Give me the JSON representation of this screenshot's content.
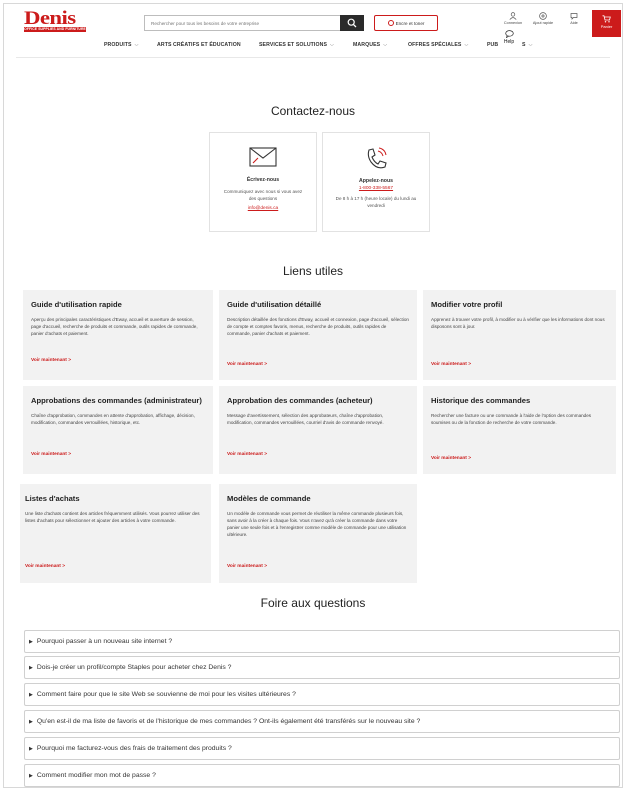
{
  "header": {
    "logo_main": "Denis",
    "logo_sub": "OFFICE SUPPLIES AND FURNITURE",
    "search_placeholder": "Rechercher pour tous les besoins de votre entreprise",
    "ink_button": "Encre et toner",
    "utilities": [
      {
        "label": "Connexion",
        "icon": "user-icon"
      },
      {
        "label": "Ajout rapide",
        "icon": "quick-add-icon"
      },
      {
        "label": "Aide",
        "icon": "chat-icon"
      }
    ],
    "cart_label": "Panier",
    "help_popup": "Help"
  },
  "nav": [
    {
      "label": "PRODUITS"
    },
    {
      "label": "ARTS CRÉATIFS ET ÉDUCATION"
    },
    {
      "label": "SERVICES ET SOLUTIONS"
    },
    {
      "label": "MARQUES"
    },
    {
      "label": "OFFRES SPÉCIALES"
    },
    {
      "label": "PUB"
    },
    {
      "label": "S"
    }
  ],
  "contact": {
    "title": "Contactez-nous",
    "email": {
      "title": "Écrivez-nous",
      "desc": "Communiquez avec nous si vous avez des questions",
      "link": "info@denis.ca"
    },
    "phone": {
      "title": "Appelez-nous",
      "link": "1-800-338-5567",
      "desc": "De 8 h à 17 h (heure locale) du lundi au vendredi"
    }
  },
  "useful_links": {
    "title": "Liens utiles",
    "cta": "Voir maintenant >",
    "cards": [
      {
        "title": "Guide d'utilisation rapide",
        "desc": "Aperçu des principales caractéristiques d'Eway, accueil et ouverture de session, page d'accueil, recherche de produits et commande, outils rapides de commande, panier d'achats et paiement."
      },
      {
        "title": "Guide d'utilisation détaillé",
        "desc": "Description détaillée des fonctions d'Eway, accueil et connexion, page d'accueil, sélection de compte et comptes favoris, menus, recherche de produits, outils rapides de commande, panier d'achats et paiement."
      },
      {
        "title": "Modifier votre profil",
        "desc": "Apprenez à trouver votre profil, à modifier ou à vérifier que les informations dont nous disposons sont à jour."
      },
      {
        "title": "Approbations des commandes (administrateur)",
        "desc": "Chaîne d'approbation, commandes en attente d'approbation, affichage, décision, modification, commandes verrouillées, historique, etc."
      },
      {
        "title": "Approbation des commandes (acheteur)",
        "desc": "Message d'avertissement, sélection des approbateurs, chaîne d'approbation, modification, commandes verrouillées, courriel d'avis de commande renvoyé."
      },
      {
        "title": "Historique des commandes",
        "desc": "Rechercher une facture ou une commande à l'aide de l'option des commandes soumises ou de la fonction de recherche de votre commande."
      },
      {
        "title": "Listes d'achats",
        "desc": "Une liste d'achats contient des articles fréquemment utilisés. Vous pourrez utiliser des listes d'achats pour sélectionner et ajouter des articles à votre commande."
      },
      {
        "title": "Modèles de commande",
        "desc": "Un modèle de commande vous permet de réutiliser la même commande plusieurs fois, sans avoir à la créer à chaque fois. Vous n'avez qu'à créer la commande dans votre panier une seule fois et à l'enregistrer comme modèle de commande pour une utilisation ultérieure."
      }
    ]
  },
  "faq": {
    "title": "Foire aux questions",
    "items": [
      "Pourquoi passer à un nouveau site internet ?",
      "Dois-je créer un profil/compte Staples pour acheter chez Denis ?",
      "Comment faire pour que le site Web se souvienne de moi pour les visites ultérieures ?",
      "Qu'en est-il de ma liste de favoris et de l'historique de mes commandes ? Ont-ils également été transférés sur le nouveau site ?",
      "Pourquoi me facturez-vous des frais de traitement des produits ?",
      "Comment modifier mon mot de passe ?"
    ]
  },
  "colors": {
    "brand_red": "#cc1b1b",
    "card_bg": "#f2f2f2"
  }
}
